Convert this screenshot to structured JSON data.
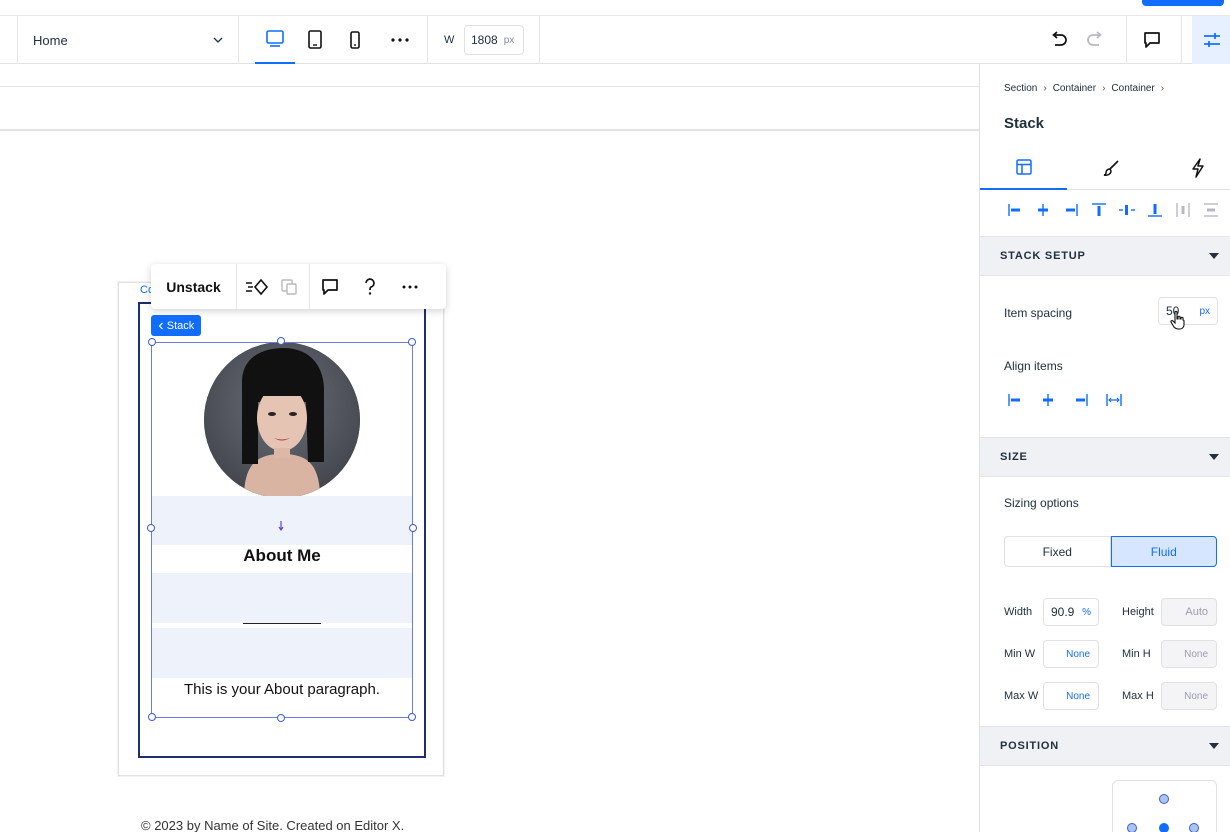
{
  "toolbar": {
    "page_name": "Home",
    "width_label": "W",
    "width_value": "1808",
    "width_unit": "px"
  },
  "action_bar": {
    "unstack_label": "Unstack"
  },
  "canvas": {
    "frame_label": "Co",
    "stack_tag": "Stack",
    "about_title": "About Me",
    "about_paragraph": "This is your About paragraph.",
    "footer": "© 2023 by Name of Site. Created on Editor X."
  },
  "panel": {
    "breadcrumb": [
      "Section",
      "Container",
      "Container"
    ],
    "title": "Stack",
    "sections": {
      "stack_setup": "STACK SETUP",
      "size": "SIZE",
      "position": "POSITION"
    },
    "item_spacing_label": "Item spacing",
    "item_spacing_value": "50",
    "item_spacing_unit": "px",
    "align_items_label": "Align items",
    "sizing_options_label": "Sizing options",
    "sizing_fixed": "Fixed",
    "sizing_fluid": "Fluid",
    "width_label": "Width",
    "width_value": "90.9",
    "width_unit": "%",
    "height_label": "Height",
    "height_value": "Auto",
    "min_w_label": "Min W",
    "min_w_value": "None",
    "min_h_label": "Min H",
    "min_h_value": "None",
    "max_w_label": "Max W",
    "max_w_value": "None",
    "max_h_label": "Max H",
    "max_h_value": "None"
  },
  "colors": {
    "accent": "#116dff",
    "panel_section_bg": "#f0f1f5",
    "selection": "#1c2e6e"
  }
}
